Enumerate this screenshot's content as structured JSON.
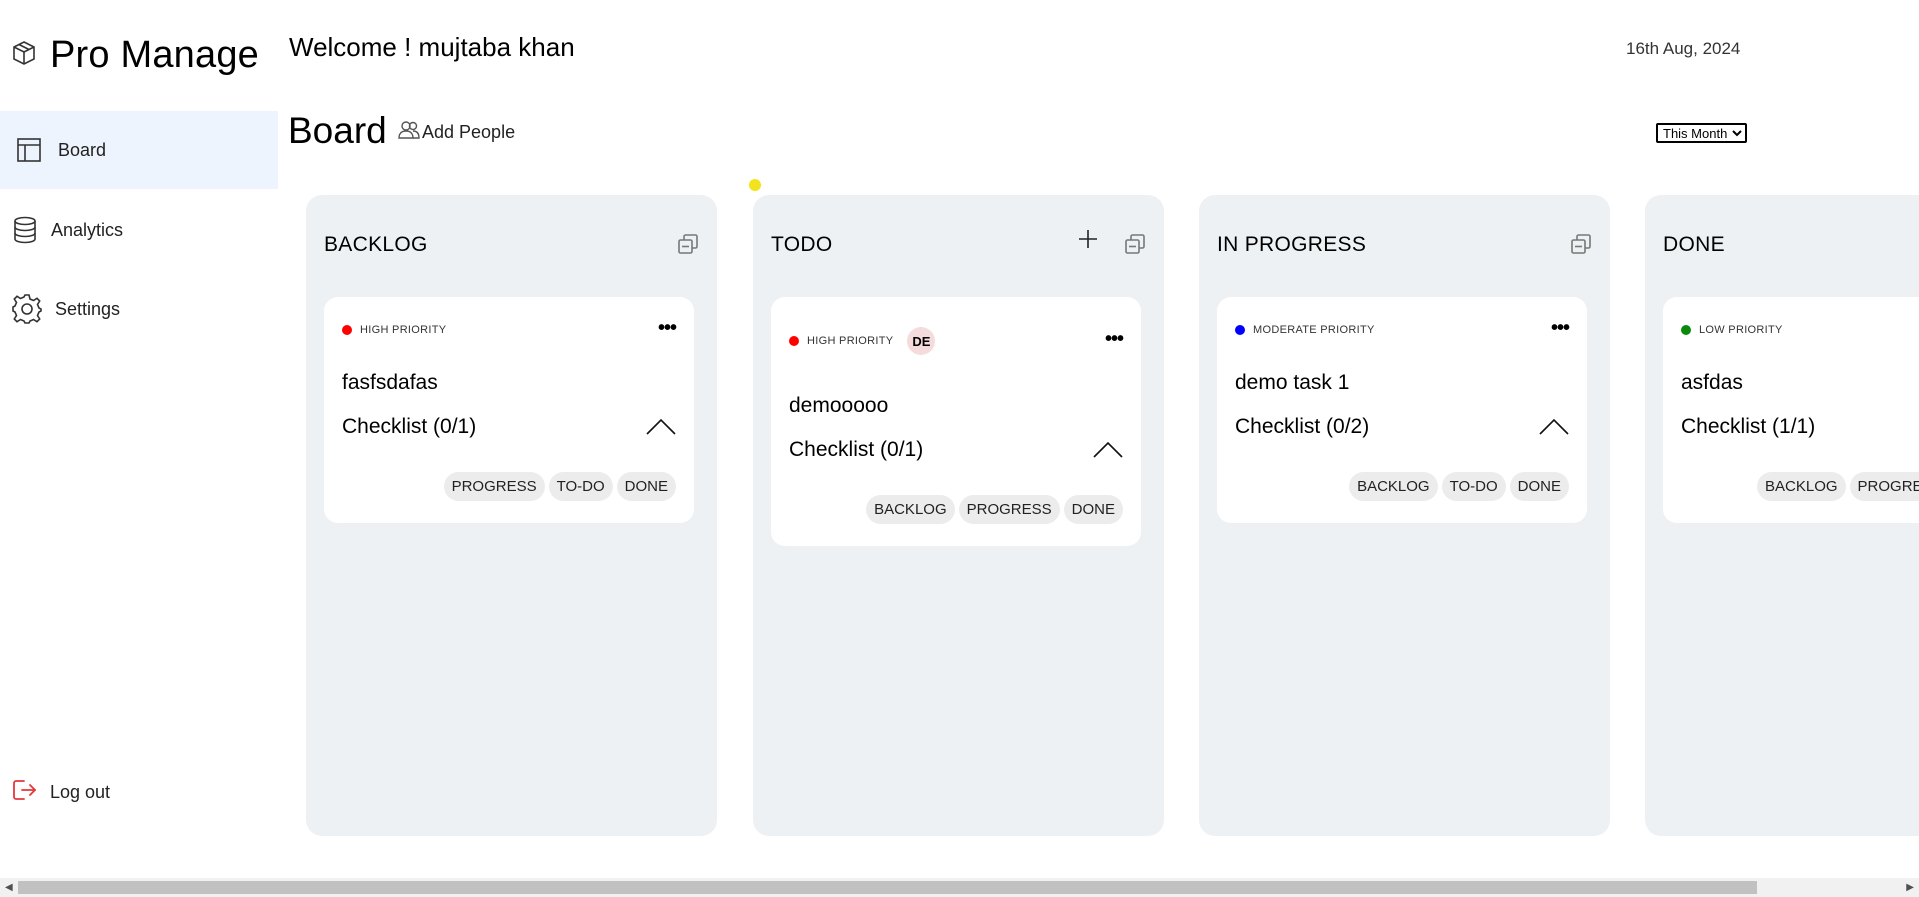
{
  "app": {
    "name": "Pro Manage"
  },
  "sidebar": {
    "items": [
      {
        "label": "Board",
        "icon": "board-icon",
        "active": true
      },
      {
        "label": "Analytics",
        "icon": "database-icon",
        "active": false
      },
      {
        "label": "Settings",
        "icon": "gear-icon",
        "active": false
      }
    ],
    "logout_label": "Log out"
  },
  "header": {
    "welcome": "Welcome ! mujtaba khan",
    "date": "16th Aug, 2024",
    "board_title": "Board",
    "add_people_label": "Add People",
    "filter": {
      "selected": "This Month"
    }
  },
  "columns": [
    {
      "title": "BACKLOG",
      "cards": [
        {
          "priority": "HIGH PRIORITY",
          "priority_color": "#ff0000",
          "assignee": "",
          "title": "fasfsdafas",
          "checklist": "Checklist (0/1)",
          "moves": [
            "PROGRESS",
            "TO-DO",
            "DONE"
          ]
        }
      ]
    },
    {
      "title": "TODO",
      "cards": [
        {
          "priority": "HIGH PRIORITY",
          "priority_color": "#ff0000",
          "assignee": "DE",
          "title": "demooooo",
          "checklist": "Checklist (0/1)",
          "moves": [
            "BACKLOG",
            "PROGRESS",
            "DONE"
          ]
        }
      ]
    },
    {
      "title": "IN PROGRESS",
      "cards": [
        {
          "priority": "MODERATE PRIORITY",
          "priority_color": "#0000ff",
          "assignee": "",
          "title": "demo task 1",
          "checklist": "Checklist (0/2)",
          "moves": [
            "BACKLOG",
            "TO-DO",
            "DONE"
          ]
        }
      ]
    },
    {
      "title": "DONE",
      "cards": [
        {
          "priority": "LOW PRIORITY",
          "priority_color": "#0a8a0a",
          "assignee": "",
          "title": "asfdas",
          "checklist": "Checklist (1/1)",
          "moves": [
            "BACKLOG",
            "PROGRESS"
          ]
        }
      ]
    }
  ]
}
